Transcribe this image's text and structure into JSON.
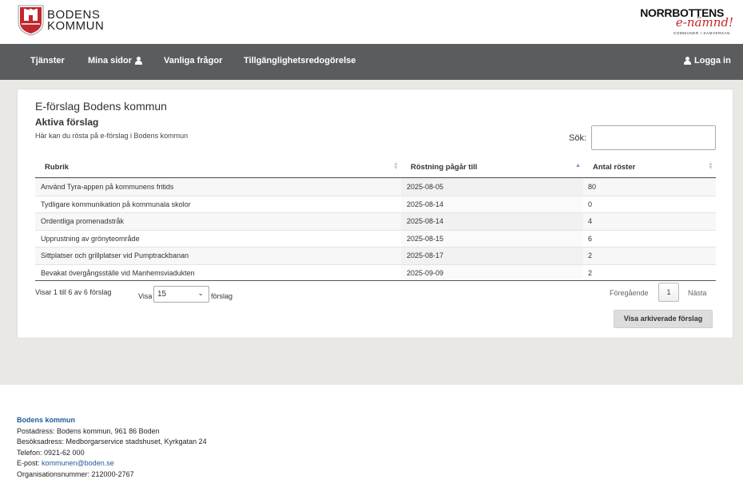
{
  "brand": {
    "left_line1": "BODENS",
    "left_line2": "KOMMUN",
    "right_title": "NORRBOTTENS",
    "right_sub": "e-nämnd!",
    "right_tag": "KOMMUNER I SAMVERKAN"
  },
  "nav": {
    "items": [
      {
        "label": "Tjänster"
      },
      {
        "label": "Mina sidor"
      },
      {
        "label": "Vanliga frågor"
      },
      {
        "label": "Tillgänglighetsredogörelse"
      }
    ],
    "login_label": "Logga in"
  },
  "page": {
    "title": "E-förslag Bodens kommun",
    "subtitle": "Aktiva förslag",
    "description": "Här kan du rösta på e-förslag i Bodens kommun",
    "search_label": "Sök:",
    "search_value": ""
  },
  "table": {
    "columns": [
      "Rubrik",
      "Röstning pågår till",
      "Antal röster"
    ],
    "rows": [
      [
        "Använd Tyra-appen på kommunens fritids",
        "2025-08-05",
        "80"
      ],
      [
        "Tydligare kommunikation på kommunala skolor",
        "2025-08-14",
        "0"
      ],
      [
        "Ordentliga promenadstråk",
        "2025-08-14",
        "4"
      ],
      [
        "Upprustning av grönyteområde",
        "2025-08-15",
        "6"
      ],
      [
        "Sittplatser och grillplatser vid Pumptrackbanan",
        "2025-08-17",
        "2"
      ],
      [
        "Bevakat övergångsställe vid Manhemsviadukten",
        "2025-09-09",
        "2"
      ]
    ]
  },
  "controls": {
    "info": "Visar 1 till 6 av 6 förslag",
    "show_label": "Visa",
    "page_size": "15",
    "page_size_suffix": "förslag",
    "prev": "Föregående",
    "current_page": "1",
    "next": "Nästa",
    "archive_button": "Visa arkiverade förslag"
  },
  "footer": {
    "org": "Bodens kommun",
    "post": "Postadress: Bodens kommun, 961 86 Boden",
    "visit": "Besöksadress: Medborgarservice stadshuset, Kyrkgatan 24",
    "phone": "Telefon: 0921-62 000",
    "email_label": "E-post: ",
    "email": "kommunen@boden.se",
    "orgnr": "Organisationsnummer: 212000-2767"
  },
  "colors": {
    "nav_bg": "#5b5c5e",
    "link": "#1f5b99",
    "crest_red": "#c1272d"
  }
}
